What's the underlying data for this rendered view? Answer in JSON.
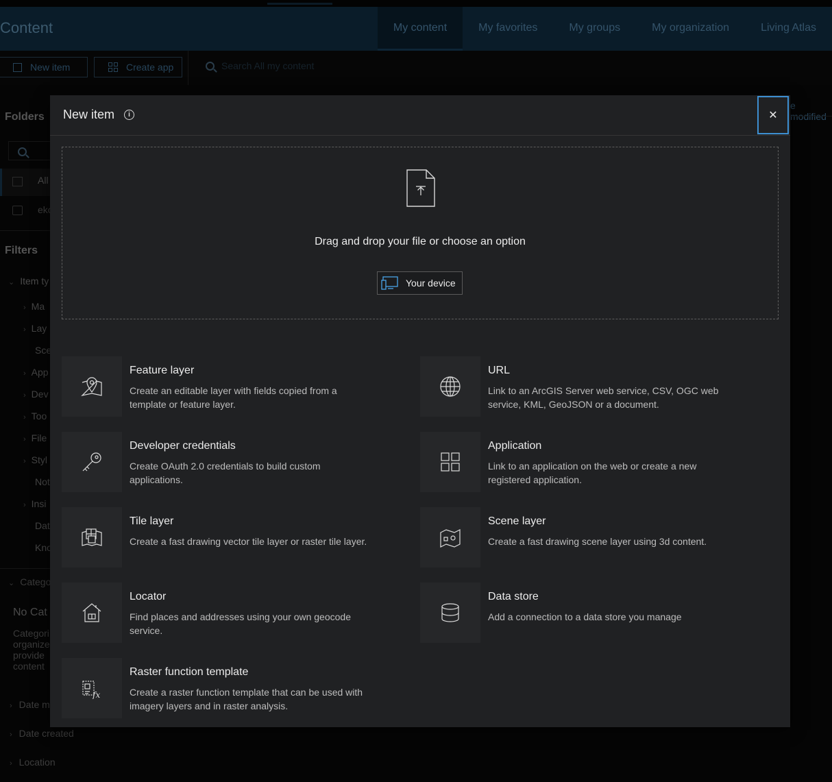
{
  "background": {
    "header": {
      "title": "Content",
      "tabs": [
        "My content",
        "My favorites",
        "My groups",
        "My organization",
        "Living Atlas"
      ]
    },
    "toolbar": {
      "new_item": "New item",
      "create_app": "Create app",
      "search_placeholder": "Search All my content"
    },
    "sort_label": "e modified",
    "sidebar": {
      "folders_heading": "Folders",
      "folder_all": "All",
      "folder_user": "eko",
      "filters_heading": "Filters",
      "item_type_heading": "Item ty",
      "item_types": [
        "Ma",
        "Lay",
        "Sce",
        "App",
        "Dev",
        "Too",
        "File",
        "Styl",
        "Not",
        "Insi",
        "Dat",
        "Kno"
      ],
      "categories_heading": "Catego",
      "no_categories": "No Cat",
      "categories_desc": [
        "Categori",
        "organize",
        "provide",
        "content"
      ],
      "date_modified": "Date m",
      "date_created": "Date created",
      "location": "Location"
    }
  },
  "modal": {
    "title": "New item",
    "close_glyph": "✕",
    "drop_text": "Drag and drop your file or choose an option",
    "device_button": "Your device",
    "options": [
      {
        "title": "Feature layer",
        "desc": "Create an editable layer with fields copied from a template or feature layer.",
        "icon": "map-pin-icon"
      },
      {
        "title": "URL",
        "desc": "Link to an ArcGIS Server web service, CSV, OGC web service, KML, GeoJSON or a document.",
        "icon": "globe-icon"
      },
      {
        "title": "Developer credentials",
        "desc": "Create OAuth 2.0 credentials to build custom applications.",
        "icon": "key-icon"
      },
      {
        "title": "Application",
        "desc": "Link to an application on the web or create a new registered application.",
        "icon": "apps-grid-icon"
      },
      {
        "title": "Tile layer",
        "desc": "Create a fast drawing vector tile layer or raster tile layer.",
        "icon": "tile-layer-icon"
      },
      {
        "title": "Scene layer",
        "desc": "Create a fast drawing scene layer using 3d content.",
        "icon": "scene-layer-icon"
      },
      {
        "title": "Locator",
        "desc": "Find places and addresses using your own geocode service.",
        "icon": "house-locator-icon"
      },
      {
        "title": "Data store",
        "desc": "Add a connection to a data store you manage",
        "icon": "database-icon"
      },
      {
        "title": "Raster function template",
        "desc": "Create a raster function template that can be used with imagery layers and in raster analysis.",
        "icon": "raster-function-icon"
      }
    ]
  }
}
